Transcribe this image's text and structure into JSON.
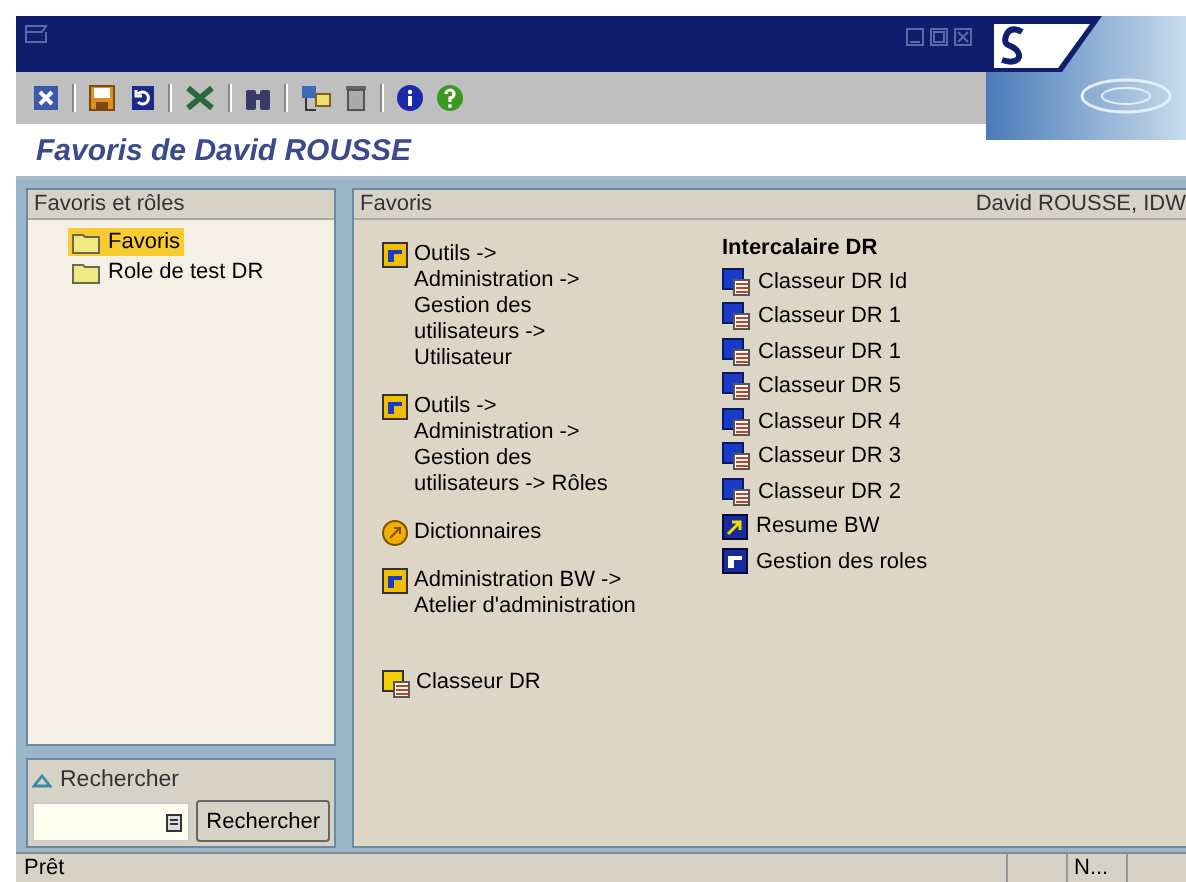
{
  "window": {
    "title": "Favoris de David ROUSSE"
  },
  "tree": {
    "header": "Favoris et rôles",
    "items": [
      {
        "label": "Favoris",
        "selected": true
      },
      {
        "label": "Role de test DR",
        "selected": false
      }
    ]
  },
  "search": {
    "header": "Rechercher",
    "button": "Rechercher"
  },
  "favorites": {
    "header": "Favoris",
    "user": "David ROUSSE, IDW",
    "items": [
      {
        "kind": "transaction",
        "label": "Outils ->\nAdministration ->\nGestion des\nutilisateurs ->\nUtilisateur"
      },
      {
        "kind": "transaction",
        "label": "Outils ->\nAdministration ->\nGestion des\nutilisateurs -> Rôles"
      },
      {
        "kind": "url",
        "label": "Dictionnaires"
      },
      {
        "kind": "transaction",
        "label": "Administration BW ->\nAtelier d'administration"
      },
      {
        "kind": "workbook",
        "label": "Classeur DR"
      }
    ],
    "folder": {
      "title": "Intercalaire DR",
      "items": [
        {
          "kind": "workbook",
          "label": "Classeur DR Id"
        },
        {
          "kind": "workbook",
          "label": "Classeur DR 1"
        },
        {
          "kind": "workbook",
          "label": "Classeur DR 1"
        },
        {
          "kind": "workbook",
          "label": "Classeur DR 5"
        },
        {
          "kind": "workbook",
          "label": "Classeur DR 4"
        },
        {
          "kind": "workbook",
          "label": "Classeur DR 3"
        },
        {
          "kind": "workbook",
          "label": "Classeur DR 2"
        },
        {
          "kind": "shortcut",
          "label": "Resume BW"
        },
        {
          "kind": "transaction",
          "label": "Gestion des roles"
        }
      ]
    }
  },
  "status_bar": {
    "message": "Prêt",
    "session": "N..."
  }
}
